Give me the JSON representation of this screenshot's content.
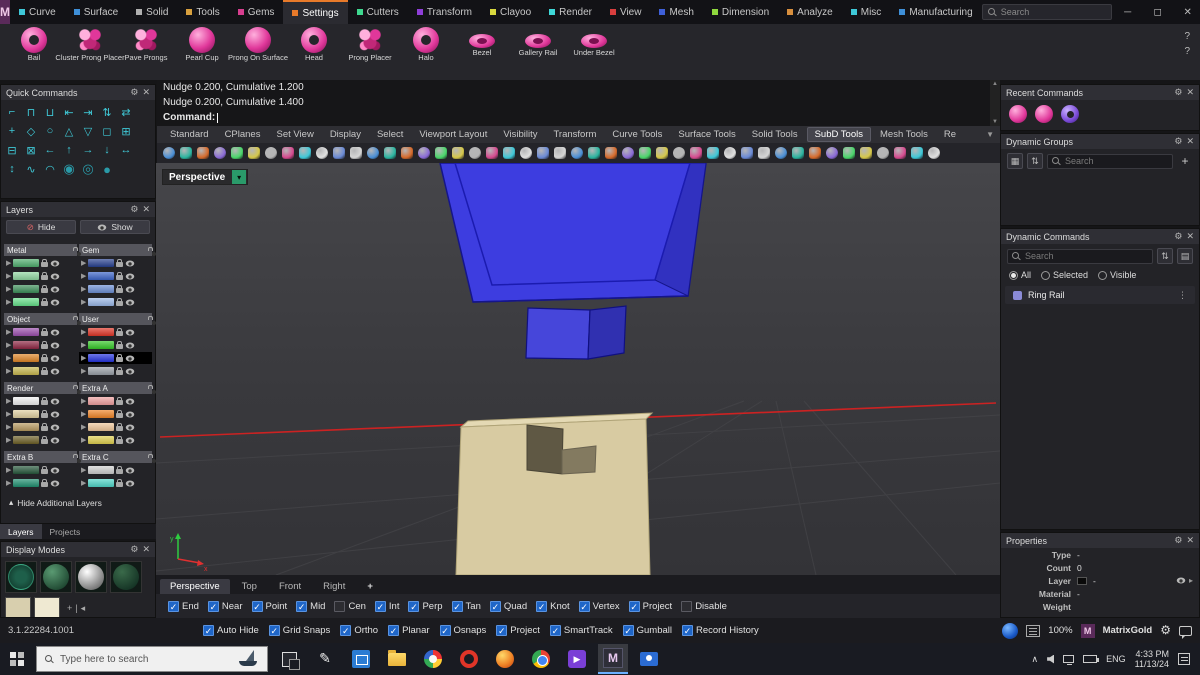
{
  "titlebar": {
    "logo": "M",
    "menus": [
      "Curve",
      "Surface",
      "Solid",
      "Tools",
      "Gems",
      "Settings",
      "Cutters",
      "Transform",
      "Clayoo",
      "Render",
      "View",
      "Mesh",
      "Dimension",
      "Analyze",
      "Misc",
      "Manufacturing"
    ],
    "active_menu": "Settings",
    "search_placeholder": "Search",
    "menu_icon_colors": [
      "#3ec8d8",
      "#3e8fd8",
      "#b0b0b0",
      "#d8a03e",
      "#d83e8f",
      "#e87a2a",
      "#3ed88f",
      "#8f3ed8",
      "#d8d83e",
      "#3ed8d8",
      "#d83e3e",
      "#3e5fd8",
      "#8fd83e",
      "#d88f3e",
      "#3ec8d8",
      "#3e8fd8"
    ]
  },
  "jewelry_toolbar": {
    "items": [
      {
        "label": "Bail",
        "shape": "ring"
      },
      {
        "label": "Cluster Prong Placer",
        "shape": "cluster"
      },
      {
        "label": "Pave Prongs",
        "shape": "cluster"
      },
      {
        "label": "Pearl Cup",
        "shape": "ball"
      },
      {
        "label": "Prong On Surface",
        "shape": "ball"
      },
      {
        "label": "Head",
        "shape": "ring"
      },
      {
        "label": "Prong Placer",
        "shape": "cluster"
      },
      {
        "label": "Halo",
        "shape": "ring"
      },
      {
        "label": "Bezel",
        "shape": "ellipse"
      },
      {
        "label": "Gallery Rail",
        "shape": "ellipse"
      },
      {
        "label": "Under Bezel",
        "shape": "ellipse"
      }
    ]
  },
  "command": {
    "lines": [
      "Nudge 0.200, Cumulative 1.200",
      "Nudge 0.200, Cumulative 1.400"
    ],
    "prompt_label": "Command:"
  },
  "toolbar_tabs": {
    "items": [
      "Standard",
      "CPlanes",
      "Set View",
      "Display",
      "Select",
      "Viewport Layout",
      "Visibility",
      "Transform",
      "Curve Tools",
      "Surface Tools",
      "Solid Tools",
      "SubD Tools",
      "Mesh Tools",
      "Re"
    ],
    "active": "SubD Tools"
  },
  "toolbar_icons": {
    "count": 46,
    "palette": [
      "#4a8fd6",
      "#2bb5a0",
      "#d66a2b",
      "#8a6ad6",
      "#4ad66a",
      "#d6c84a",
      "#b5b5b5",
      "#d64a8f",
      "#3ec8d8",
      "#e0e0e0",
      "#6a8ad6",
      "#d6d6d6"
    ]
  },
  "quick_commands": {
    "title": "Quick Commands",
    "icons": [
      "⌐",
      "⊓",
      "⊔",
      "⇤",
      "⇥",
      "⇅",
      "⇄",
      "+",
      "◇",
      "○",
      "△",
      "▽",
      "◻",
      "⊞",
      "⊟",
      "⊠",
      "←",
      "↑",
      "→",
      "↓",
      "↔",
      "↕",
      "∿",
      "◠",
      "◉",
      "◎",
      "●"
    ]
  },
  "layers_panel": {
    "title": "Layers",
    "hide_label": "Hide",
    "show_label": "Show",
    "groups": [
      {
        "cols": [
          {
            "name": "Metal",
            "rows": [
              {
                "c": "#4fae6e"
              },
              {
                "c": "#8fd6a0"
              },
              {
                "c": "#3d8f5a"
              },
              {
                "c": "#66e08a"
              }
            ]
          },
          {
            "name": "Gem",
            "rows": [
              {
                "c": "#27408f"
              },
              {
                "c": "#3c64c8"
              },
              {
                "c": "#6c8fd6"
              },
              {
                "c": "#9ab8e8"
              }
            ]
          }
        ]
      },
      {
        "cols": [
          {
            "name": "Object",
            "rows": [
              {
                "c": "#9b4fae"
              },
              {
                "c": "#8f2744"
              },
              {
                "c": "#e08527"
              },
              {
                "c": "#c8b84f"
              }
            ]
          },
          {
            "name": "User",
            "rows": [
              {
                "c": "#e03527"
              },
              {
                "c": "#35c827"
              },
              {
                "c": "#2735e0",
                "sel": true
              },
              {
                "c": "#9aa0a8"
              }
            ]
          }
        ]
      },
      {
        "cols": [
          {
            "name": "Render",
            "rows": [
              {
                "c": "#f0f0f0"
              },
              {
                "c": "#e0d0a0"
              },
              {
                "c": "#b89a60"
              },
              {
                "c": "#6e6027"
              }
            ]
          },
          {
            "name": "Extra A",
            "rows": [
              {
                "c": "#f0a0a0"
              },
              {
                "c": "#f08527"
              },
              {
                "c": "#f0c89a"
              },
              {
                "c": "#e0d04f"
              }
            ]
          }
        ]
      },
      {
        "cols": [
          {
            "name": "Extra B",
            "rows": [
              {
                "c": "#27583c"
              },
              {
                "c": "#1f8f70"
              }
            ]
          },
          {
            "name": "Extra C",
            "rows": [
              {
                "c": "#d0d0d0"
              },
              {
                "c": "#4fd6c8"
              }
            ]
          }
        ]
      }
    ],
    "hide_additional_label": "Hide Additional Layers",
    "tabs": [
      {
        "label": "Layers",
        "active": true
      },
      {
        "label": "Projects",
        "active": false
      }
    ]
  },
  "display_modes": {
    "title": "Display Modes",
    "spheres": [
      "wire",
      "shaded",
      "pearl",
      "dark"
    ]
  },
  "viewport": {
    "label": "Perspective",
    "tabs": [
      {
        "label": "Perspective",
        "active": true
      },
      {
        "label": "Top",
        "active": false
      },
      {
        "label": "Front",
        "active": false
      },
      {
        "label": "Right",
        "active": false
      }
    ],
    "add_tab_label": "+"
  },
  "osnap": {
    "items": [
      {
        "label": "End",
        "checked": true
      },
      {
        "label": "Near",
        "checked": true
      },
      {
        "label": "Point",
        "checked": true
      },
      {
        "label": "Mid",
        "checked": true
      },
      {
        "label": "Cen",
        "checked": false
      },
      {
        "label": "Int",
        "checked": true
      },
      {
        "label": "Perp",
        "checked": true
      },
      {
        "label": "Tan",
        "checked": true
      },
      {
        "label": "Quad",
        "checked": true
      },
      {
        "label": "Knot",
        "checked": true
      },
      {
        "label": "Vertex",
        "checked": true
      },
      {
        "label": "Project",
        "checked": true
      },
      {
        "label": "Disable",
        "checked": false
      }
    ]
  },
  "recent_commands": {
    "title": "Recent Commands",
    "icons": [
      "gem-pink",
      "gem-pink",
      "ring-purple"
    ]
  },
  "dynamic_groups": {
    "title": "Dynamic Groups",
    "search_placeholder": "Search",
    "add_label": "+"
  },
  "dynamic_commands": {
    "title": "Dynamic Commands",
    "search_placeholder": "Search",
    "filters": [
      {
        "label": "All",
        "selected": true
      },
      {
        "label": "Selected",
        "selected": false
      },
      {
        "label": "Visible",
        "selected": false
      }
    ],
    "items": [
      {
        "label": "Ring Rail",
        "color": "#8a8ad6"
      }
    ]
  },
  "properties": {
    "title": "Properties",
    "rows": [
      {
        "label": "Type",
        "value": "-"
      },
      {
        "label": "Count",
        "value": "0"
      },
      {
        "label": "Layer",
        "value": "-",
        "swatch": "#0a0a0a"
      },
      {
        "label": "Material",
        "value": "-"
      },
      {
        "label": "Weight",
        "value": ""
      }
    ]
  },
  "statusbar": {
    "version": "3.1.22284.1001",
    "toggles": [
      {
        "label": "Auto Hide",
        "checked": true
      },
      {
        "label": "Grid Snaps",
        "checked": true
      },
      {
        "label": "Ortho",
        "checked": true
      },
      {
        "label": "Planar",
        "checked": true
      },
      {
        "label": "Osnaps",
        "checked": true
      },
      {
        "label": "Project",
        "checked": true
      },
      {
        "label": "SmartTrack",
        "checked": true
      },
      {
        "label": "Gumball",
        "checked": true
      },
      {
        "label": "Record History",
        "checked": true
      }
    ],
    "zoom": "100%",
    "brand": "MatrixGold"
  },
  "taskbar": {
    "search_placeholder": "Type here to search",
    "icons": [
      "task-view",
      "ink-pen",
      "store",
      "file-explorer",
      "paint",
      "opera",
      "firefox",
      "chrome",
      "media-player",
      "matrixgold",
      "people"
    ],
    "active_icon": "matrixgold",
    "tray": {
      "lang": "ENG",
      "time": "4:33 PM",
      "date": "11/13/24"
    }
  }
}
